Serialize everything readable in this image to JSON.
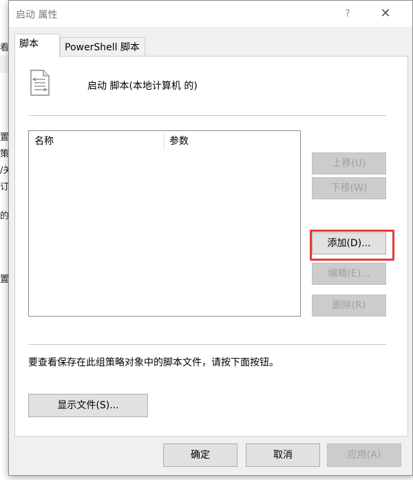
{
  "background": {
    "fragments": [
      "看",
      "置",
      "策",
      "/关",
      "订",
      "的",
      "置"
    ]
  },
  "dialog": {
    "title": "启动 属性",
    "help_glyph": "?",
    "close_glyph": "✕"
  },
  "tabs": [
    {
      "label": "脚本",
      "active": true
    },
    {
      "label": "PowerShell 脚本",
      "active": false
    }
  ],
  "header": {
    "text": "启动 脚本(本地计算机 的)",
    "icon": "script-document-icon"
  },
  "table": {
    "columns": [
      "名称",
      "参数"
    ],
    "rows": []
  },
  "side_buttons": [
    {
      "label": "上移(U)",
      "enabled": false
    },
    {
      "label": "下移(W)",
      "enabled": false
    },
    {
      "label": "添加(D)...",
      "enabled": true
    },
    {
      "label": "编辑(E)...",
      "enabled": false
    },
    {
      "label": "删除(R)",
      "enabled": false
    }
  ],
  "note": "要查看保存在此组策略对象中的脚本文件，请按下面按钮。",
  "show_files_button": "显示文件(S)...",
  "footer": {
    "ok": "确定",
    "cancel": "取消",
    "apply": "应用(A)"
  },
  "colors": {
    "highlight": "#e53935",
    "disabled_text": "#a0a0a0"
  }
}
